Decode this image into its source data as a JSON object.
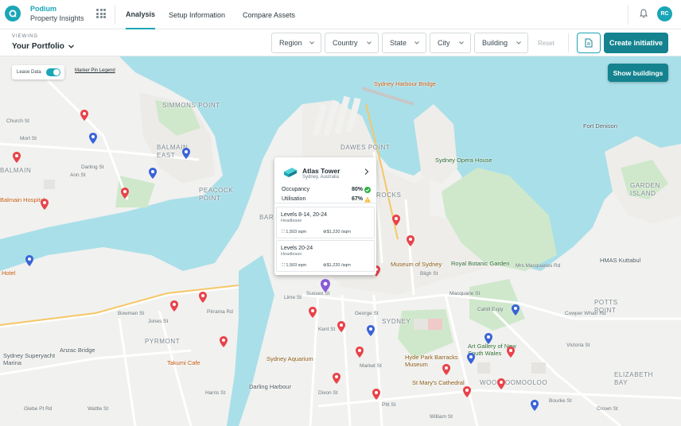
{
  "app": {
    "brand_line1": "Podium",
    "brand_line2": "Property Insights",
    "tabs": [
      {
        "label": "Analysis",
        "active": true
      },
      {
        "label": "Setup Information",
        "active": false
      },
      {
        "label": "Compare Assets",
        "active": false
      }
    ],
    "user_initials": "RC",
    "accent_color": "#1aa6b7",
    "button_color": "#14838f"
  },
  "filters": {
    "viewing_label": "VIEWING",
    "portfolio": "Your Portfolio",
    "dropdowns": [
      "Region",
      "Country",
      "State",
      "City",
      "Building"
    ],
    "reset_label": "Reset",
    "create_label": "Create initiative"
  },
  "map": {
    "lease_data_label": "Lease Data",
    "lease_data_on": true,
    "legend_link": "Marker Pin Legend",
    "show_buildings_label": "Show buildings",
    "suburbs": [
      "SIMMONS POINT",
      "BALMAIN EAST",
      "DAWES POINT",
      "PEACOCK POINT",
      "GARDEN ISLAND",
      "POTTS POINT",
      "PYRMONT",
      "SYDNEY",
      "ELIZABETH BAY",
      "WOOLLOOMOOLOO",
      "BALMAIN",
      "ROCKS",
      "BAR"
    ],
    "places": [
      "Sydney Harbour Bridge",
      "Fort Denison",
      "Sydney Opera House",
      "Royal Botanic Garden",
      "Museum of Sydney",
      "HMAS Kuttabul",
      "Art Gallery of New South Wales",
      "Hyde Park Barracks Museum",
      "St Mary's Cathedral",
      "Sydney Aquarium",
      "Darling Harbour",
      "Takumi Cafe",
      "Anzac Bridge",
      "Balmain Hospital",
      "Hotel",
      "Sydney Superyacht Marina"
    ],
    "streets": [
      "Darling St",
      "Church St",
      "Mort St",
      "Ann St",
      "Bowman St",
      "Jones St",
      "Harris St",
      "Pirrama Rd",
      "Market St",
      "Sussex St",
      "William St",
      "Bligh St",
      "Macquarie St",
      "Cahill Expy",
      "Mrs Macquaries Rd",
      "Victoria St",
      "Pitt St",
      "George St",
      "Lime St",
      "Kent St",
      "Wattle St",
      "Glebe Pt Rd",
      "Dixon St",
      "Bourke St",
      "Crown St",
      "Cowper Wharf Rd"
    ]
  },
  "popup": {
    "building_name": "Atlas Tower",
    "location": "Sydney, Australia",
    "occupancy_label": "Occupancy",
    "occupancy_value": "80%",
    "utilisation_label": "Utilisation",
    "utilisation_value": "67%",
    "leases": [
      {
        "title": "Levels 8-14, 20-24",
        "type": "Headlease",
        "area": "1,503 sqm",
        "rate": "$1,220 /sqm"
      },
      {
        "title": "Levels 20-24",
        "type": "Headlease",
        "area": "1,503 sqm",
        "rate": "$1,220 /sqm"
      }
    ]
  },
  "pin_colors": {
    "red": "#e8434a",
    "blue": "#3a63d8",
    "purple": "#8a5ad6"
  }
}
